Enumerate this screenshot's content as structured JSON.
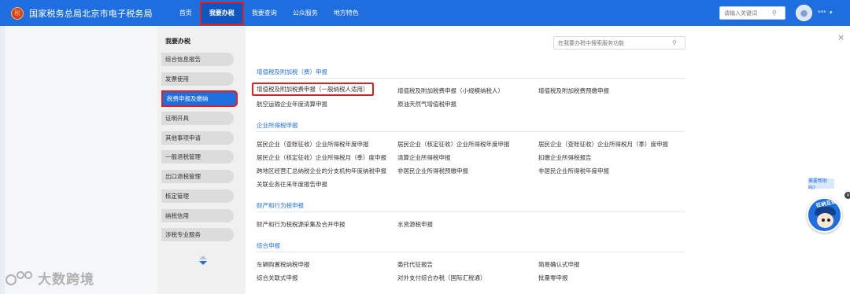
{
  "header": {
    "logo_glyph": "税",
    "title": "国家税务总局北京市电子税务局",
    "nav": [
      "首页",
      "我要办税",
      "我要查询",
      "公众服务",
      "地方特色"
    ],
    "active_nav": 1,
    "search_placeholder": "请输入关键词",
    "user_name": "***",
    "user_caret": "▾",
    "search_icon": "search-icon",
    "accent_color": "#1e6ee0"
  },
  "sidebar": {
    "title": "我要办税",
    "items": [
      "综合信息报告",
      "发票使用",
      "税费申报及缴纳",
      "证明开具",
      "其他事项申请",
      "一般退税管理",
      "出口退税管理",
      "核定管理",
      "纳税信用",
      "涉税专业服务"
    ],
    "active_index": 2
  },
  "panel": {
    "search_placeholder": "在我要办税中搜索服务功能",
    "close": "×",
    "sections": [
      {
        "title": "增值税及附加税（费）申报",
        "links": [
          "增值税及附加税费申报（一般纳税人适用）",
          "增值税及附加税费申报（小规模纳税人）",
          "增值税及附加税费预缴申报",
          "航空运输企业年度清算申报",
          "原油天然气增值税申报"
        ]
      },
      {
        "title": "企业所得税申报",
        "links": [
          "居民企业（查账征收）企业所得税年度申报",
          "居民企业（核定征收）企业所得税年度申报",
          "居民企业（查账征收）企业所得税月（季）度申报",
          "居民企业（核定征收）企业所得税月（季）度申报",
          "清算企业所得税申报",
          "扣缴企业所得税报告",
          "跨地区经营汇总纳税企业的分支机构年度纳税申报",
          "非居民企业所得税预缴申报",
          "非居民企业所得税年度申报",
          "关联业务往来年度报告申报"
        ]
      },
      {
        "title": "财产和行为税申报",
        "links": [
          "财产和行为税税源采集及合并申报",
          "水资源税申报"
        ]
      },
      {
        "title": "综合申报",
        "links": [
          "车辆购置税纳税申报",
          "委托代征报告",
          "简易确认式申报",
          "综合关联式申报",
          "对外支付综合办税（国际汇税通）",
          "批量零申报"
        ]
      }
    ],
    "highlighted_link": "增值税及附加税费申报（一般纳税人适用）"
  },
  "widgets": {
    "help_tip": "需要帮助吗?",
    "help_close": "×",
    "mascot_label": "征纳互动"
  },
  "watermark": {
    "text": "大数跨境"
  }
}
